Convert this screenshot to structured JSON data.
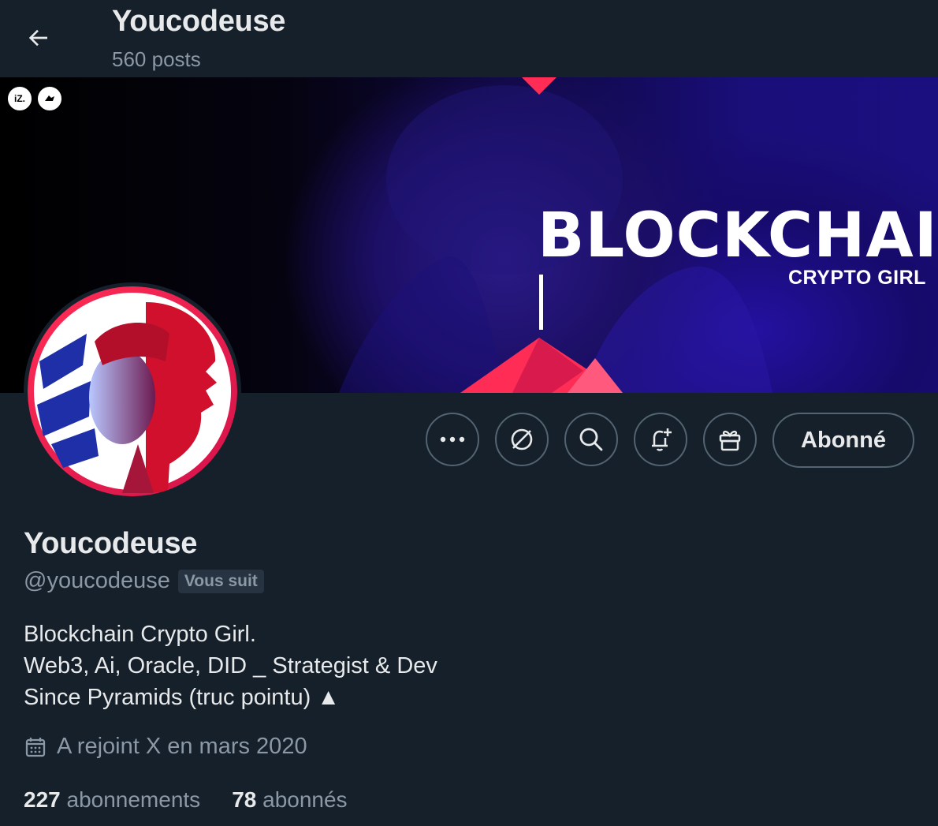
{
  "header": {
    "title": "Youcodeuse",
    "posts_count": "560 posts",
    "back_icon": "arrow-left-icon"
  },
  "banner": {
    "brand_word": "BLOCKCHAIN",
    "brand_sub": "CRYPTO GIRL",
    "small_logos": [
      "iZ.",
      "rider"
    ],
    "accent_color": "#ff2d55"
  },
  "actions": {
    "more_icon": "more-icon",
    "grok_icon": "grok-icon",
    "search_icon": "search-icon",
    "notify_icon": "bell-plus-icon",
    "gift_icon": "gift-icon",
    "follow_label": "Abonné"
  },
  "profile": {
    "name": "Youcodeuse",
    "handle": "@youcodeuse",
    "follows_you": "Vous suit",
    "bio": [
      "Blockchain Crypto Girl.",
      "Web3, Ai, Oracle, DID _ Strategist & Dev",
      "Since Pyramids (truc pointu) ▲"
    ],
    "joined": "A rejoint X en mars 2020",
    "following_count": "227",
    "following_label": "abonnements",
    "followers_count": "78",
    "followers_label": "abonnés"
  },
  "colors": {
    "background": "#15202b",
    "text": "#e7e9ea",
    "muted": "#8b98a5",
    "border": "#536471"
  }
}
